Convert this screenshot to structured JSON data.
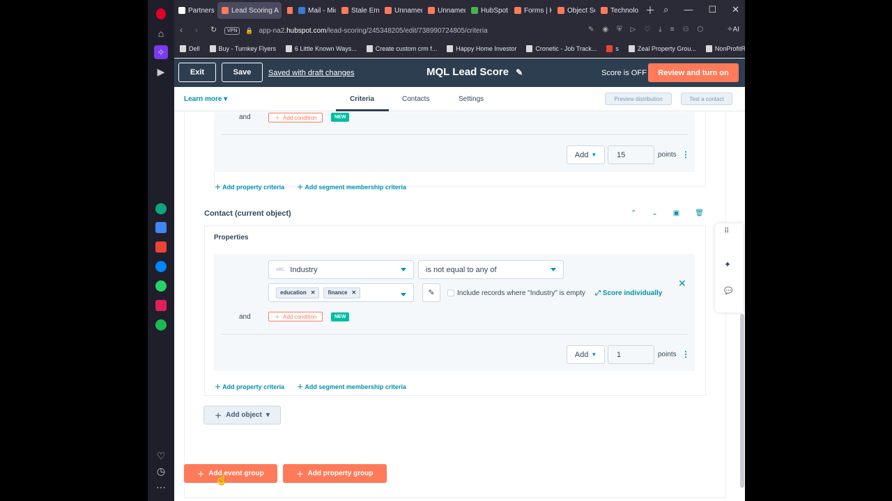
{
  "browser": {
    "tabs": [
      {
        "label": "Partners po",
        "color": "#ffffff",
        "active": false
      },
      {
        "label": "Lead Scoring A",
        "color": "#ff7a59",
        "active": true
      },
      {
        "label": "",
        "color": "#ff7a59",
        "active": false
      },
      {
        "label": "Mail - Mich",
        "color": "#3a7bd5",
        "active": false
      },
      {
        "label": "Stale Email",
        "color": "#ff7a59",
        "active": false
      },
      {
        "label": "Unnamed",
        "color": "#ff7a59",
        "active": false
      },
      {
        "label": "Unnamed",
        "color": "#ff7a59",
        "active": false
      },
      {
        "label": "HubSpot -",
        "color": "#4caf50",
        "active": false
      },
      {
        "label": "Forms | Hu",
        "color": "#ff7a59",
        "active": false
      },
      {
        "label": "Object Set",
        "color": "#ff7a59",
        "active": false
      },
      {
        "label": "Technolog",
        "color": "#ff7a59",
        "active": false
      }
    ],
    "vpn": "VPN",
    "url_prefix": "app-na2.",
    "url_domain": "hubspot.com",
    "url_path": "/lead-scoring/245348205/edit/738990724805/criteria",
    "ai_label": "AI",
    "bookmarks": [
      "Dell",
      "Buy - Turnkey Flyers",
      "6 Little Known Ways...",
      "Create custom crm f...",
      "Happy Home Investor",
      "Cronetic - Job Track...",
      "s",
      "Zeal Property Grou...",
      "NonProfitRef"
    ]
  },
  "header": {
    "exit": "Exit",
    "save": "Save",
    "saved_status": "Saved with draft changes",
    "title": "MQL Lead Score",
    "score_status": "Score is OFF",
    "review": "Review and turn on"
  },
  "subnav": {
    "learn_more": "Learn more",
    "tabs": [
      "Criteria",
      "Contacts",
      "Settings"
    ],
    "preview": "Preview distribution",
    "test": "Test a contact"
  },
  "group1": {
    "and": "and",
    "add_condition": "Add condition",
    "new": "NEW",
    "add_btn": "Add",
    "points_value": "15",
    "points_label": "points",
    "add_property_criteria": "Add property criteria",
    "add_segment_criteria": "Add segment membership criteria"
  },
  "group2": {
    "object_title": "Contact (current object)",
    "properties_label": "Properties",
    "property_field": "Industry",
    "property_field_icon": "ABC",
    "operator": "is not equal to any of",
    "chips": [
      "education",
      "finance"
    ],
    "include_label": "Include records where \"Industry\" is empty",
    "score_individually": "Score individually",
    "and": "and",
    "add_condition": "Add condition",
    "new": "NEW",
    "add_btn": "Add",
    "points_value": "1",
    "points_label": "points",
    "add_property_criteria": "Add property criteria",
    "add_segment_criteria": "Add segment membership criteria"
  },
  "footer": {
    "add_object": "Add object",
    "add_event_group": "Add event group",
    "add_property_group": "Add property group"
  },
  "colors": {
    "accent": "#ff7a59",
    "header_bg": "#2d3e50",
    "link": "#0091ae",
    "teal_badge": "#00bda5"
  }
}
